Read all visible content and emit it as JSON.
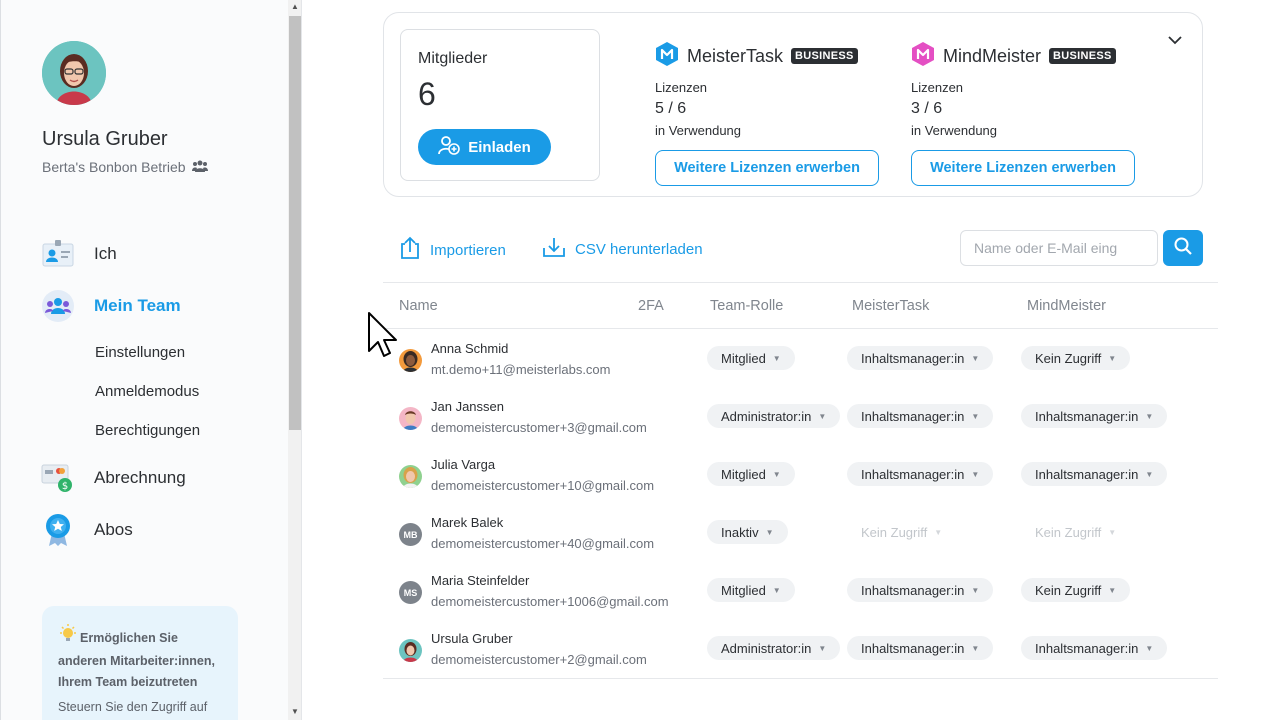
{
  "sidebar": {
    "user_name": "Ursula Gruber",
    "org_name": "Berta's Bonbon Betrieb",
    "nav": {
      "me": "Ich",
      "team": "Mein Team",
      "settings": "Einstellungen",
      "login_mode": "Anmeldemodus",
      "permissions": "Berechtigungen",
      "billing": "Abrechnung",
      "subscriptions": "Abos"
    },
    "tip": {
      "title": "Ermöglichen Sie anderen Mitarbeiter:innen, Ihrem Team beizutreten",
      "text": "Steuern Sie den Zugriff auf"
    }
  },
  "overview": {
    "members_label": "Mitglieder",
    "members_count": "6",
    "invite_label": "Einladen",
    "products": [
      {
        "name": "MeisterTask",
        "badge": "BUSINESS",
        "license_label": "Lizenzen",
        "license_count": "5 / 6",
        "usage_label": "in Verwendung",
        "buy_label": "Weitere Lizenzen erwerben",
        "color": "#1a9be6"
      },
      {
        "name": "MindMeister",
        "badge": "BUSINESS",
        "license_label": "Lizenzen",
        "license_count": "3 / 6",
        "usage_label": "in Verwendung",
        "buy_label": "Weitere Lizenzen erwerben",
        "color": "#e44fc3"
      }
    ]
  },
  "toolbar": {
    "import_label": "Importieren",
    "csv_label": "CSV herunterladen",
    "search_placeholder": "Name oder E-Mail eing"
  },
  "table": {
    "headers": {
      "name": "Name",
      "twofa": "2FA",
      "role": "Team-Rolle",
      "mt": "MeisterTask",
      "mm": "MindMeister"
    },
    "rows": [
      {
        "name": "Anna Schmid",
        "email": "mt.demo+11@meisterlabs.com",
        "role": "Mitglied",
        "mt": "Inhaltsmanager:in",
        "mm": "Kein Zugriff"
      },
      {
        "name": "Jan Janssen",
        "email": "demomeistercustomer+3@gmail.com",
        "role": "Administrator:in",
        "mt": "Inhaltsmanager:in",
        "mm": "Inhaltsmanager:in"
      },
      {
        "name": "Julia Varga",
        "email": "demomeistercustomer+10@gmail.com",
        "role": "Mitglied",
        "mt": "Inhaltsmanager:in",
        "mm": "Inhaltsmanager:in"
      },
      {
        "name": "Marek Balek",
        "initials": "MB",
        "email": "demomeistercustomer+40@gmail.com",
        "role": "Inaktiv",
        "mt": "Kein Zugriff",
        "mm": "Kein Zugriff"
      },
      {
        "name": "Maria Steinfelder",
        "initials": "MS",
        "email": "demomeistercustomer+1006@gmail.com",
        "role": "Mitglied",
        "mt": "Inhaltsmanager:in",
        "mm": "Kein Zugriff"
      },
      {
        "name": "Ursula Gruber",
        "email": "demomeistercustomer+2@gmail.com",
        "role": "Administrator:in",
        "mt": "Inhaltsmanager:in",
        "mm": "Inhaltsmanager:in"
      }
    ]
  },
  "colors": {
    "accent": "#1a9be6",
    "text": "#2c2f33",
    "muted": "#6b7079"
  }
}
